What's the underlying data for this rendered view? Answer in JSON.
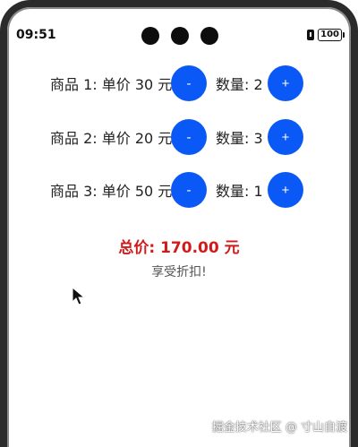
{
  "status_bar": {
    "time": "09:51",
    "battery": "100",
    "icons": [
      "sim-alert-icon",
      "battery-icon"
    ]
  },
  "items": [
    {
      "label": "商品 1: 单价 30 元",
      "qty_label": "数量: 2",
      "minus": "-",
      "plus": "+"
    },
    {
      "label": "商品 2: 单价 20 元",
      "qty_label": "数量: 3",
      "minus": "-",
      "plus": "+"
    },
    {
      "label": "商品 3: 单价 50 元",
      "qty_label": "数量: 1",
      "minus": "-",
      "plus": "+"
    }
  ],
  "summary": {
    "total": "总价: 170.00 元",
    "discount": "享受折扣!"
  },
  "watermark": "掘金技术社区 @ 寸山自渡",
  "colors": {
    "button": "#0a59f7",
    "total": "#d11a1a"
  }
}
